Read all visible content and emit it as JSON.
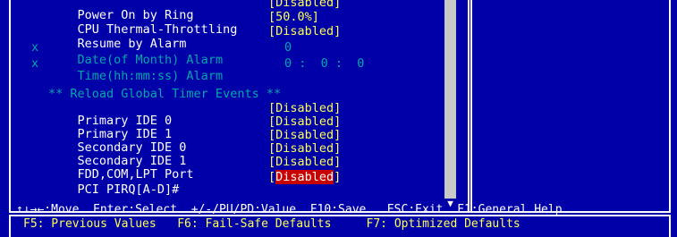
{
  "settings_top": [
    {
      "label": "Power On by Ring",
      "value": "[Disabled]",
      "dim": false
    },
    {
      "label": "CPU Thermal-Throttling",
      "value": "[50.0%]",
      "dim": false
    },
    {
      "label": "Resume by Alarm",
      "value": "[Disabled]",
      "dim": false
    },
    {
      "marker": "x",
      "label": "Date(of Month) Alarm",
      "value": "0",
      "dim": true
    },
    {
      "marker": "x",
      "label": "Time(hh:mm:ss) Alarm",
      "value": "0 :  0 :  0",
      "dim": true
    }
  ],
  "section_header": "** Reload Global Timer Events **",
  "settings_bottom": [
    {
      "label": "Primary IDE 0",
      "value": "[Disabled]"
    },
    {
      "label": "Primary IDE 1",
      "value": "[Disabled]"
    },
    {
      "label": "Secondary IDE 0",
      "value": "[Disabled]"
    },
    {
      "label": "Secondary IDE 1",
      "value": "[Disabled]"
    },
    {
      "label": "FDD,COM,LPT Port",
      "value": "[Disabled]"
    },
    {
      "label": "PCI PIRQ[A-D]#",
      "value": "[Disabled]"
    }
  ],
  "selected_value": "Disabled",
  "footer": {
    "line1": {
      "move": "↑↓→←:Move",
      "select": "Enter:Select",
      "value": "+/-/PU/PD:Value",
      "save": "F10:Save",
      "exit": "ESC:Exit",
      "help": "F1:General Help"
    },
    "line2": {
      "previous": "F5: Previous Values",
      "failsafe": "F6: Fail-Safe Defaults",
      "optimized": "F7: Optimized Defaults"
    }
  },
  "colors": {
    "background": "#0000a8",
    "value": "#ffff55",
    "dim": "#00a8a8",
    "selected": "#c80000"
  }
}
